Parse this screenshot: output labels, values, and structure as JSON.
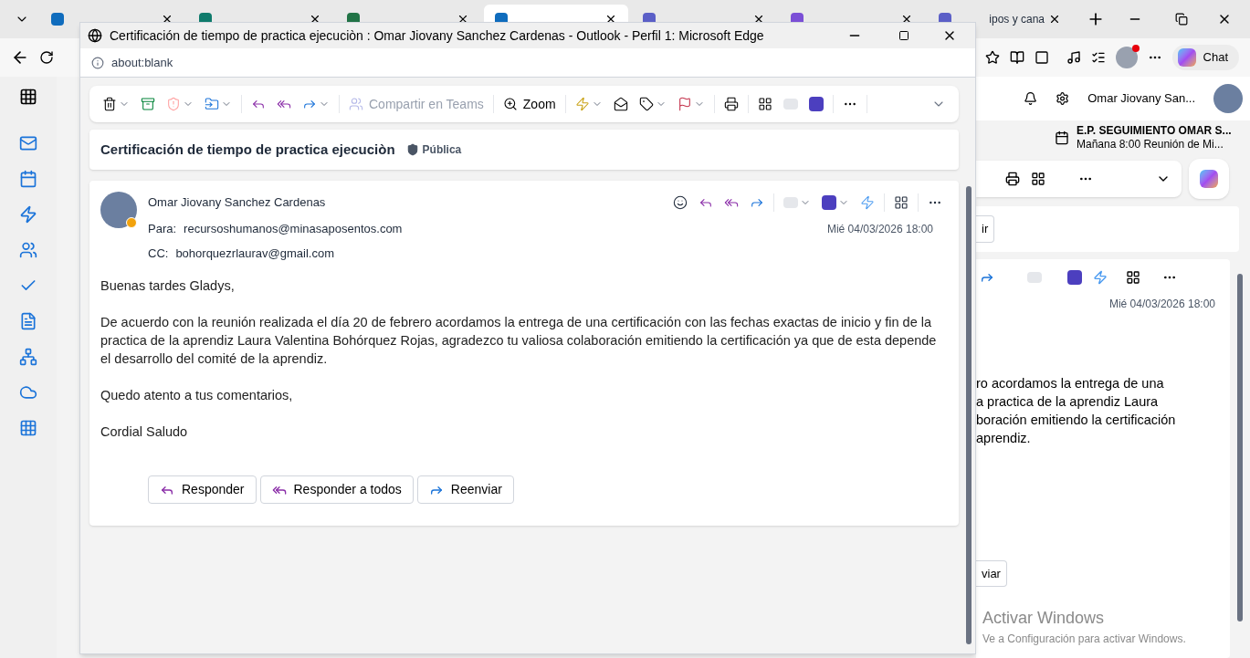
{
  "browser": {
    "tabs": [
      {
        "selected": false,
        "color": "#0f6cbd"
      },
      {
        "selected": false,
        "color": "#0f7b6c"
      },
      {
        "selected": false,
        "color": "#217346"
      },
      {
        "selected": true,
        "color": "#0f6cbd"
      },
      {
        "selected": false,
        "color": "#5b5fc7"
      },
      {
        "selected": false,
        "color": "#7b4fd6"
      },
      {
        "title": "ipos y cana",
        "selected": false,
        "color": "#5b5fc7"
      }
    ],
    "chat_button": "Chat"
  },
  "outlook_background": {
    "user_name": "Omar Jiovany San...",
    "reminder_title": "E.P. SEGUIMIENTO OMAR S...",
    "reminder_subtitle": "Mañana 8:00 Reunión de Mi...",
    "button_fragment": "ir",
    "date": "Mié 04/03/2026 18:00",
    "body_fragments": [
      "ro acordamos la entrega de una",
      "a practica de la aprendiz  Laura",
      "boración emitiendo la certificación",
      "aprendiz."
    ],
    "forward_fragment": "viar"
  },
  "popup": {
    "title": "Certificación de tiempo de practica ejecuciòn : Omar Jiovany Sanchez Cardenas - Outlook - Perfil 1: Microsoft Edge",
    "address": "about:blank",
    "toolbar": {
      "teams": {
        "label": "Compartir en Teams",
        "disabled": true
      },
      "zoom": "Zoom"
    },
    "subject": "Certificación de tiempo de practica ejecuciòn",
    "sensitivity": "Pública",
    "message": {
      "sender": "Omar Jiovany Sanchez Cardenas",
      "to_label": "Para:",
      "to": "recursoshumanos@minasaposentos.com",
      "cc_label": "CC:",
      "cc": "bohorquezrlaurav@gmail.com",
      "date": "Mié 04/03/2026 18:00",
      "body": [
        "Buenas tardes Gladys,",
        "De acuerdo con la reunión realizada el día 20 de febrero acordamos la entrega de una certificación con las fechas exactas de inicio y fin de la practica de la aprendiz  Laura Valentina Bohórquez Rojas, agradezco tu valiosa colaboración emitiendo la certificación ya que de esta depende el desarrollo del comité de la aprendiz.",
        "Quedo atento a tus comentarios,",
        "Cordial Saludo"
      ],
      "actions": [
        "Responder",
        "Responder a todos",
        "Reenviar"
      ]
    }
  },
  "activation": {
    "title": "Activar Windows",
    "subtitle": "Ve a Configuración para activar Windows."
  }
}
